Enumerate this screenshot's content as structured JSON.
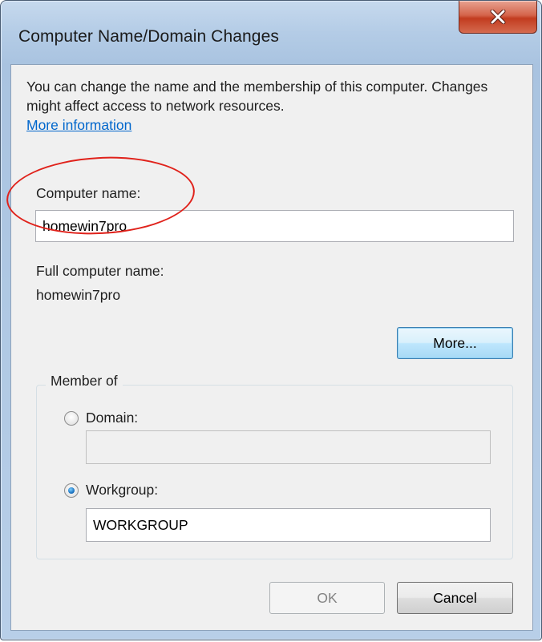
{
  "window": {
    "title": "Computer Name/Domain Changes",
    "close_icon": "close-x-icon"
  },
  "intro": {
    "text": "You can change the name and the membership of this computer. Changes might affect access to network resources.",
    "link": "More information"
  },
  "computer_name": {
    "label": "Computer name:",
    "value": "homewin7pro"
  },
  "full_name": {
    "label": "Full computer name:",
    "value": "homewin7pro"
  },
  "more_button": "More...",
  "member_of": {
    "legend": "Member of",
    "domain_label": "Domain:",
    "domain_value": "",
    "domain_selected": false,
    "workgroup_label": "Workgroup:",
    "workgroup_value": "WORKGROUP",
    "workgroup_selected": true
  },
  "buttons": {
    "ok": "OK",
    "cancel": "Cancel",
    "ok_enabled": false
  },
  "colors": {
    "annotation": "#e0221b",
    "link": "#0066cc",
    "close_button": "#c23c1f"
  }
}
